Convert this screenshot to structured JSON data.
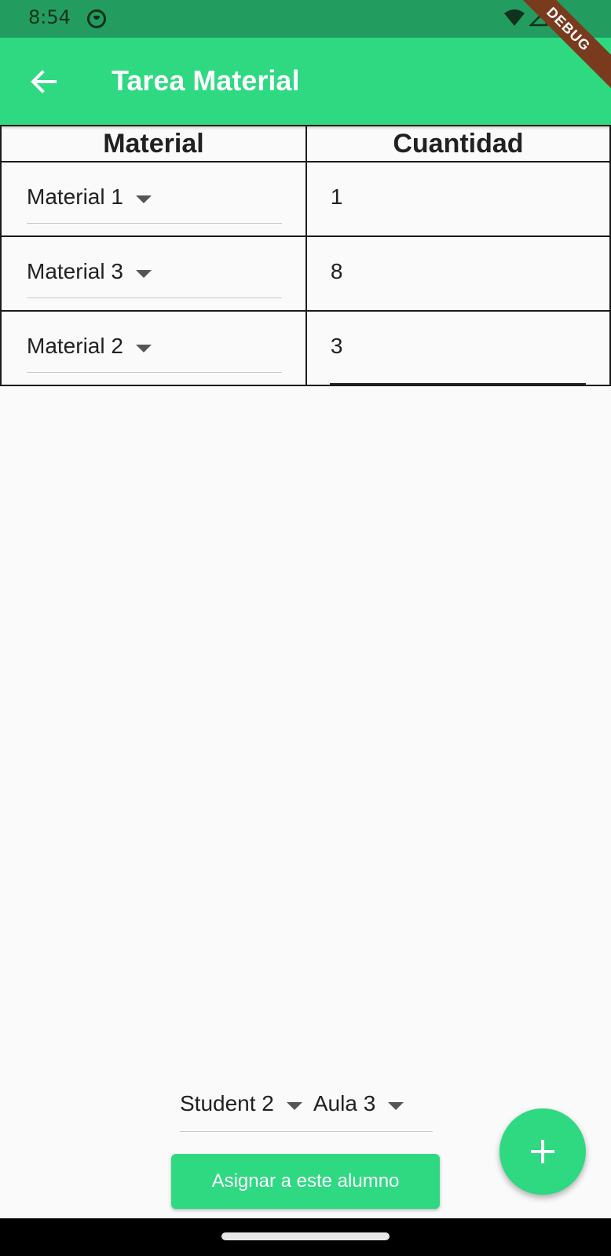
{
  "status_bar": {
    "time": "8:54"
  },
  "debug_banner": "DEBUG",
  "app_bar": {
    "title": "Tarea Material",
    "back_icon": "arrow-left-icon"
  },
  "table": {
    "headers": [
      "Material",
      "Cuantidad"
    ],
    "rows": [
      {
        "material": "Material 1",
        "quantity": "1"
      },
      {
        "material": "Material 3",
        "quantity": "8"
      },
      {
        "material": "Material 2",
        "quantity": "3"
      }
    ]
  },
  "assignment": {
    "student": "Student 2",
    "classroom": "Aula 3",
    "assign_label": "Asignar a este alumno"
  },
  "fab": {
    "icon": "plus-icon"
  },
  "colors": {
    "primary": "#2ed982",
    "status_bar": "#239d5f",
    "background": "#fafafa"
  }
}
